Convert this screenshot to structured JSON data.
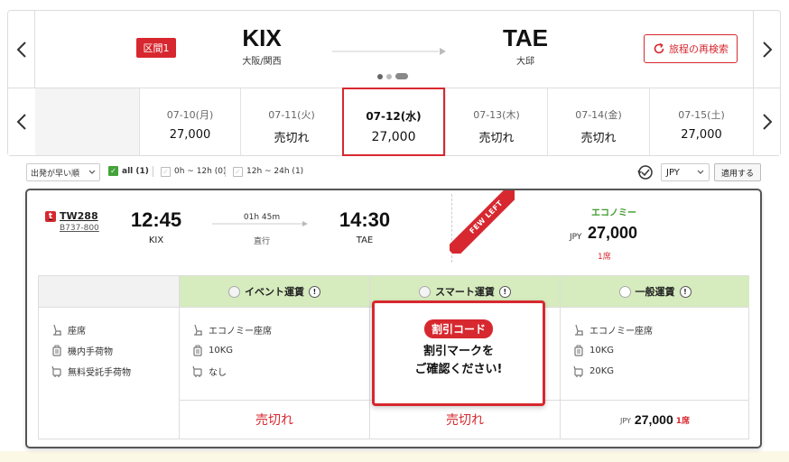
{
  "route": {
    "section_badge": "区間1",
    "origin_code": "KIX",
    "origin_name": "大阪/関西",
    "dest_code": "TAE",
    "dest_name": "大邱",
    "research_label": "旅程の再検索"
  },
  "dates": [
    {
      "date": "07-10(月)",
      "price": "27,000"
    },
    {
      "date": "07-11(火)",
      "price": "売切れ"
    },
    {
      "date": "07-12(水)",
      "price": "27,000",
      "selected": true
    },
    {
      "date": "07-13(木)",
      "price": "売切れ"
    },
    {
      "date": "07-14(金)",
      "price": "売切れ"
    },
    {
      "date": "07-15(土)",
      "price": "27,000"
    }
  ],
  "filters": {
    "sort_label": "出発が早い順",
    "options": [
      "all (1)",
      "0h ~ 12h (0)",
      "12h ~ 24h (1)"
    ],
    "currency": "JPY",
    "apply_label": "適用する"
  },
  "flight": {
    "number": "TW288",
    "aircraft": "B737-800",
    "airline_mark": "t",
    "dep_time": "12:45",
    "dep_airport": "KIX",
    "duration": "01h 45m",
    "stops": "直行",
    "arr_time": "14:30",
    "arr_airport": "TAE",
    "ribbon": "FEW LEFT",
    "cabin_class": "エコノミー",
    "price_currency": "JPY",
    "price": "27,000",
    "seats": "1席"
  },
  "fares": {
    "features": [
      "座席",
      "機内手荷物",
      "無料受託手荷物"
    ],
    "columns": [
      {
        "name": "イベント運賃",
        "items": [
          "エコノミー座席",
          "10KG",
          "なし"
        ],
        "footer": "売切れ"
      },
      {
        "name": "スマート運賃",
        "items": [],
        "footer": "売切れ"
      },
      {
        "name": "一般運賃",
        "items": [
          "エコノミー座席",
          "10KG",
          "20KG"
        ],
        "footer_currency": "JPY",
        "footer_price": "27,000",
        "footer_seats": "1席"
      }
    ]
  },
  "promo": {
    "badge": "割引コード",
    "line1": "割引マークを",
    "line2": "ご確認ください!"
  },
  "colors": {
    "accent_red": "#d7282f",
    "fare_green": "#d6ebbe",
    "class_green": "#3d9a2a"
  }
}
